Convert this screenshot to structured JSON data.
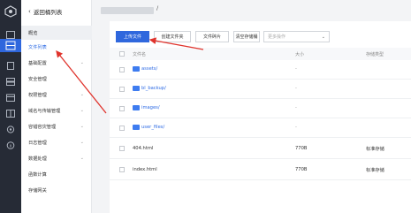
{
  "rail": {
    "icons": [
      "logo-icon",
      "dashboard-icon",
      "storage-icon",
      "document-icon",
      "server-icon",
      "calendar-icon",
      "network-icon",
      "settings-icon",
      "shield-icon",
      "info-icon"
    ]
  },
  "sidebar": {
    "back_label": "返回桶列表",
    "items": [
      {
        "label": "概览"
      },
      {
        "label": "文件列表"
      },
      {
        "label": "基础配置"
      },
      {
        "label": "安全管理"
      },
      {
        "label": "权限管理"
      },
      {
        "label": "域名与传输管理"
      },
      {
        "label": "容错容灾管理"
      },
      {
        "label": "日志管理"
      },
      {
        "label": "数据处理"
      },
      {
        "label": "函数计算"
      },
      {
        "label": "存储网关"
      }
    ]
  },
  "topbar": {
    "separator": "/"
  },
  "toolbar": {
    "upload": "上传文件",
    "new_folder": "创建文件夹",
    "fragments": "文件碎片",
    "clear_bucket": "清空存储桶",
    "more": "更多操作"
  },
  "table": {
    "headers": [
      "文件名",
      "大小",
      "存储类型"
    ],
    "rows": [
      {
        "name": "assets/",
        "size": "-",
        "type": "",
        "folder": true
      },
      {
        "name": "bl_backup/",
        "size": "-",
        "type": "",
        "folder": true
      },
      {
        "name": "images/",
        "size": "-",
        "type": "",
        "folder": true
      },
      {
        "name": "user_files/",
        "size": "-",
        "type": "",
        "folder": true
      },
      {
        "name": "404.html",
        "size": "770B",
        "type": "标准存储",
        "folder": false
      },
      {
        "name": "index.html",
        "size": "770B",
        "type": "标准存储",
        "folder": false
      }
    ]
  },
  "colors": {
    "accent": "#2f67dd",
    "arrow": "#e0332c",
    "rail": "#262b36"
  }
}
